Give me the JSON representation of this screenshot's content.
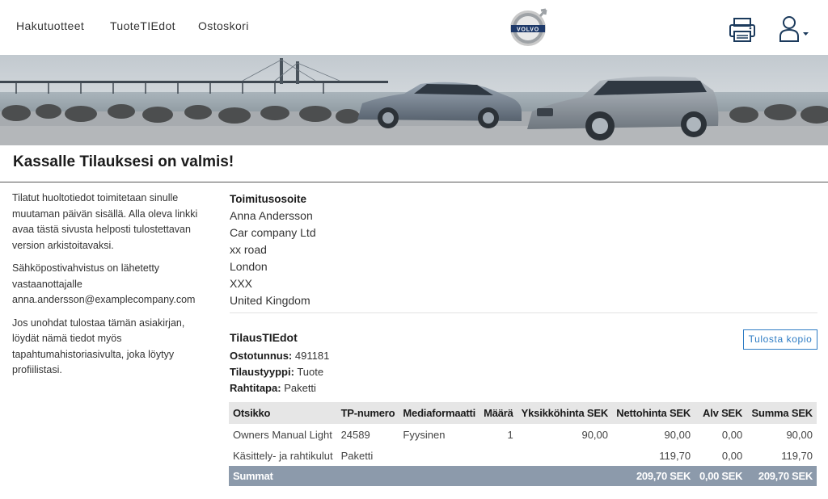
{
  "header": {
    "nav": [
      {
        "label": "Hakutuotteet"
      },
      {
        "label": "TuoteTIEdot"
      },
      {
        "label": "Ostoskori"
      }
    ],
    "logo_text": "VOLVO",
    "icons": {
      "print": "printer-icon",
      "user": "user-icon",
      "dropdown": "caret-down-icon"
    }
  },
  "page": {
    "title": "Kassalle Tilauksesi on valmis!"
  },
  "info": {
    "p1": "Tilatut huoltotiedot toimitetaan sinulle muutaman päivän sisällä. Alla oleva linkki avaa tästä sivusta helposti tulostettavan version arkistoitavaksi.",
    "p2": "Sähköpostivahvistus on lähetetty vastaanottajalle anna.andersson@examplecompany.com",
    "p3": "Jos unohdat tulostaa tämän asiakirjan, löydät nämä tiedot myös tapahtumahistoriasivulta, joka löytyy profiilistasi."
  },
  "address": {
    "label": "Toimitusosoite",
    "lines": [
      "Anna Andersson",
      "Car company Ltd",
      "xx road",
      "London",
      "XXX",
      "United Kingdom"
    ]
  },
  "order": {
    "heading": "TilausTIEdot",
    "number_label": "Ostotunnus:",
    "number": "491181",
    "type_label": "Tilaustyyppi:",
    "type": "Tuote",
    "shipping_label": "Rahtitapa:",
    "shipping": "Paketti",
    "print_copy": "Tulosta kopio"
  },
  "table": {
    "headers": [
      "Otsikko",
      "TP-numero",
      "Mediaformaatti",
      "Määrä",
      "Yksikköhinta SEK",
      "Nettohinta SEK",
      "Alv SEK",
      "Summa SEK"
    ],
    "rows": [
      [
        "Owners Manual Light",
        "24589",
        "Fyysinen",
        "1",
        "90,00",
        "90,00",
        "0,00",
        "90,00"
      ],
      [
        "Käsittely- ja rahtikulut",
        "Paketti",
        "",
        "",
        "",
        "119,70",
        "0,00",
        "119,70"
      ]
    ],
    "summary": {
      "label": "Summat",
      "net": "209,70 SEK",
      "vat": "0,00 SEK",
      "total": "209,70 SEK"
    }
  },
  "colors": {
    "accent": "#2e7cc4",
    "summary_bg": "#8c9aab",
    "header_bg": "#e6e6e6"
  }
}
